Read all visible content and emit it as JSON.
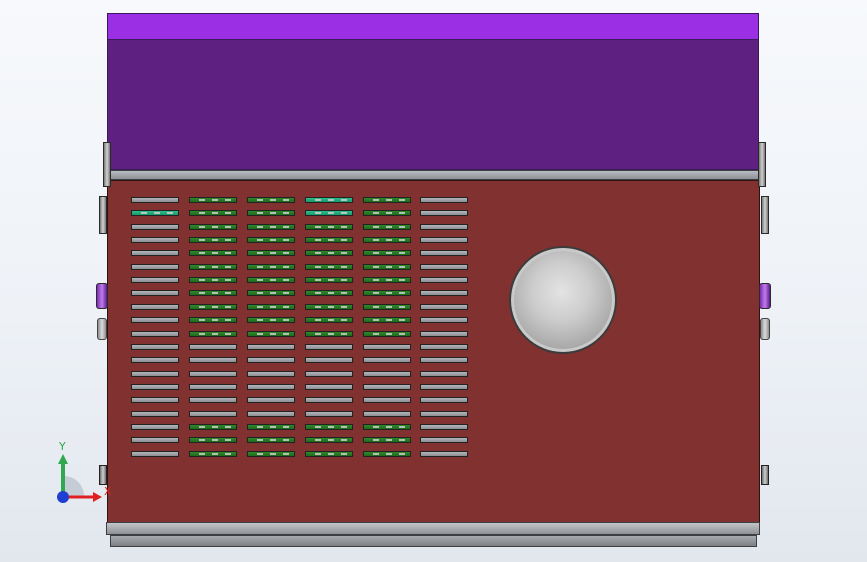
{
  "viewport": {
    "background_top": "#f7f9fc",
    "background_bottom": "#e2e7ee"
  },
  "model": {
    "lid_top_color": "#9a2fe3",
    "lid_face_color": "#5e2181",
    "housing_color": "#813230",
    "rail_color": "#a7aaae",
    "vent_green": "#2f8a2b",
    "vent_teal": "#2fc08c",
    "knob_color": "#c8c8c8",
    "vent_grille": {
      "columns": 6,
      "rows": 20
    }
  },
  "triad": {
    "y_label": "Y",
    "x_label": "X",
    "y_axis_color": "#2fa84f",
    "x_axis_color": "#e02020",
    "z_axis_color": "#1f3fd0"
  }
}
